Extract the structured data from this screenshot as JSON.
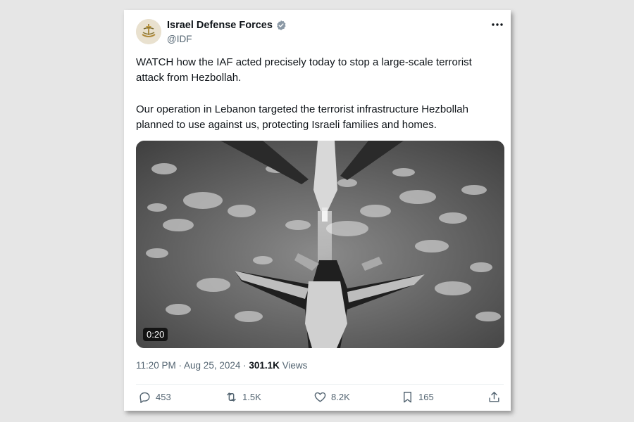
{
  "tweet": {
    "author_name": "Israel Defense Forces",
    "author_handle": "@IDF",
    "paragraph1": "WATCH how the IAF acted precisely today to stop a large-scale terrorist attack from Hezbollah.",
    "paragraph2": "Our operation in Lebanon targeted the terrorist infrastructure Hezbollah planned to use against us, protecting Israeli families and homes.",
    "video_duration": "0:20",
    "timestamp": "11:20 PM · Aug 25, 2024 · ",
    "views_count": "301.1K",
    "views_label": " Views"
  },
  "actions": {
    "replies": "453",
    "reposts": "1.5K",
    "likes": "8.2K",
    "bookmarks": "165"
  },
  "icons": {
    "verified": "verified-badge-icon",
    "more": "more-icon",
    "reply": "reply-icon",
    "repost": "repost-icon",
    "like": "heart-icon",
    "bookmark": "bookmark-icon",
    "share": "share-icon"
  },
  "colors": {
    "verified_blue": "#1d9bf0",
    "secondary_text": "#536471",
    "primary_text": "#0f1419"
  }
}
